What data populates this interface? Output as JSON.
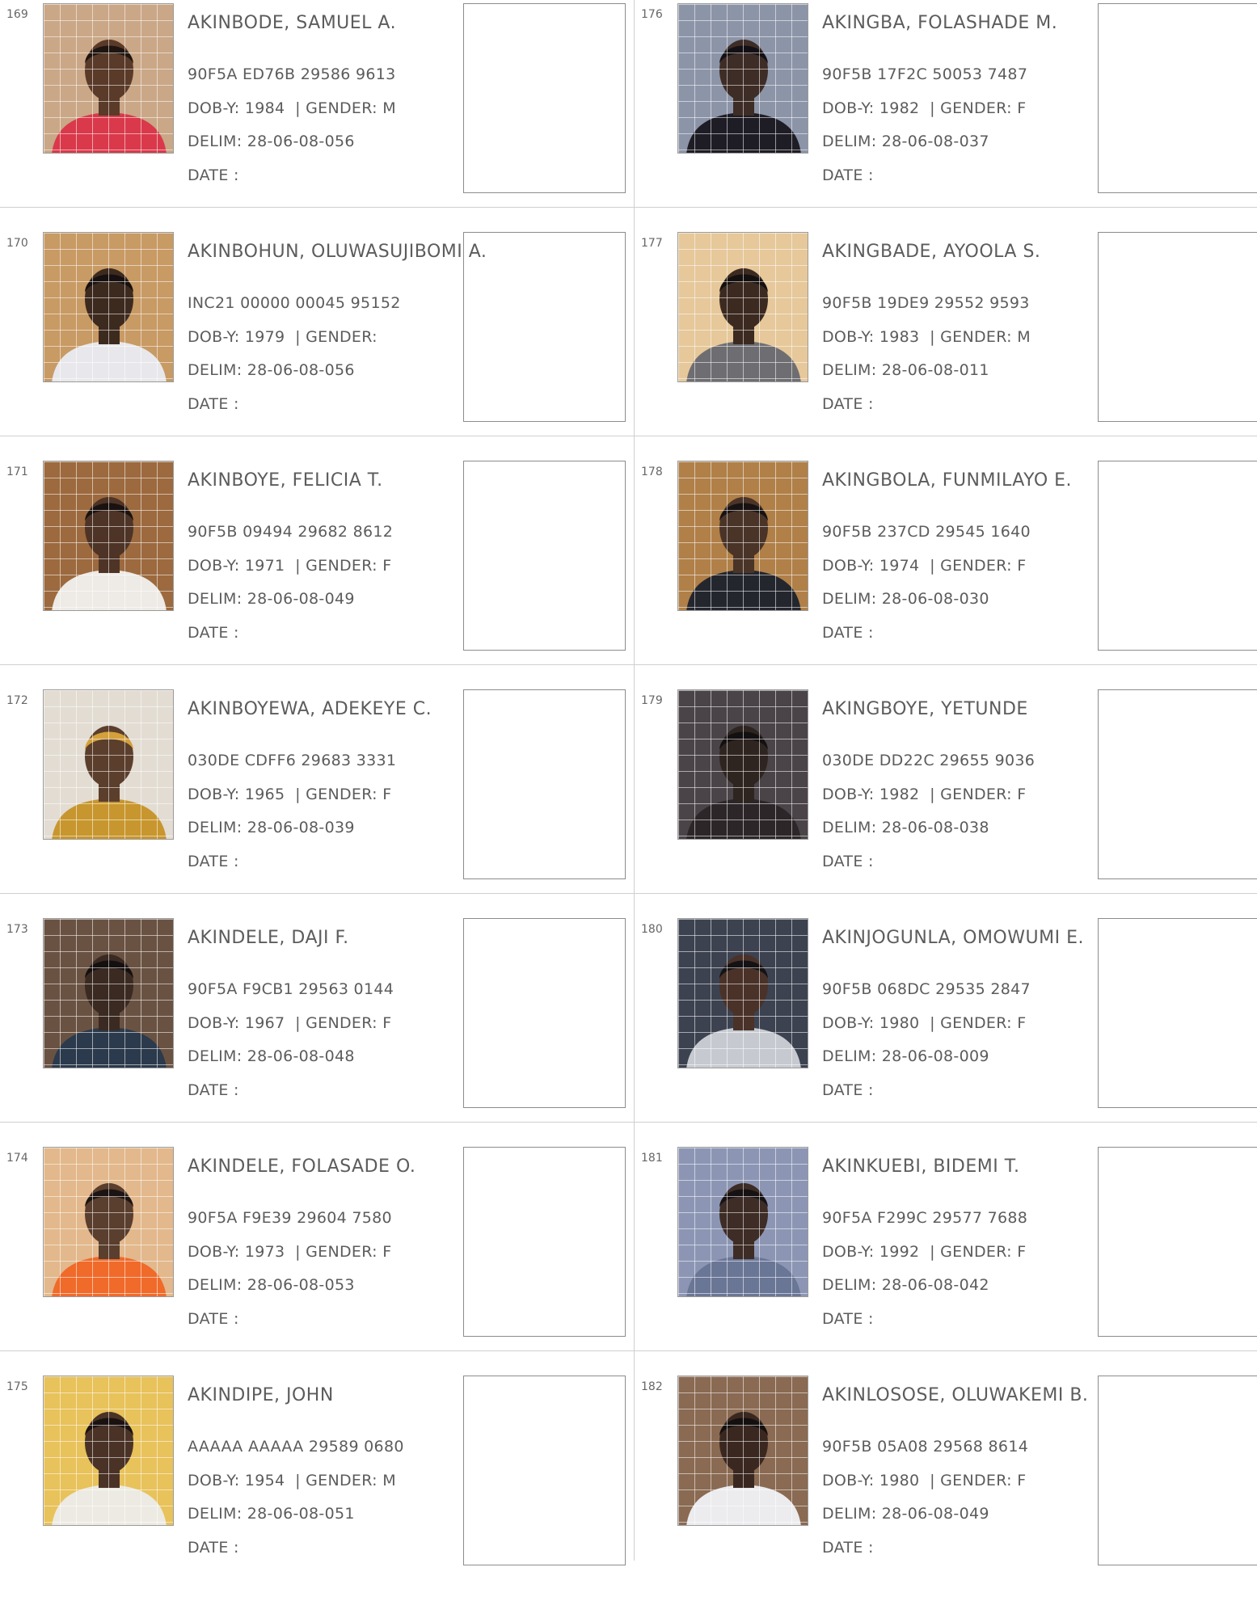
{
  "entries": [
    {
      "serial": "169",
      "name": "AKINBODE, SAMUEL A.",
      "vin": "90F5A ED76B 29586 9613",
      "dob": "1984",
      "gender": "M",
      "delim": "28-06-08-056",
      "date_label": "DATE  :",
      "photo": {
        "bg": "#caa786",
        "shirt": "#d9394a",
        "skin": "#5a3a28",
        "hair": "#1e1410"
      }
    },
    {
      "serial": "170",
      "name": "AKINBOHUN, OLUWASUJIBOMI A.",
      "vin": "INC21 00000 00045 95152",
      "dob": "1979",
      "gender": "",
      "delim": "28-06-08-056",
      "date_label": "DATE  :",
      "photo": {
        "bg": "#c89a64",
        "shirt": "#e8e8ec",
        "skin": "#3d2a1f",
        "hair": "#161010"
      }
    },
    {
      "serial": "171",
      "name": "AKINBOYE, FELICIA T.",
      "vin": "90F5B 09494 29682 8612",
      "dob": "1971",
      "gender": "F",
      "delim": "28-06-08-049",
      "date_label": "DATE  :",
      "photo": {
        "bg": "#9c6a3e",
        "shirt": "#eeeae6",
        "skin": "#4e3426",
        "hair": "#1a1210"
      }
    },
    {
      "serial": "172",
      "name": "AKINBOYEWA, ADEKEYE C.",
      "vin": "030DE CDFF6 29683 3331",
      "dob": "1965",
      "gender": "F",
      "delim": "28-06-08-039",
      "date_label": "DATE  :",
      "photo": {
        "bg": "#e2dcd2",
        "shirt": "#c8962e",
        "skin": "#5b3e2c",
        "hair": "#d4a03a"
      }
    },
    {
      "serial": "173",
      "name": "AKINDELE, DAJI F.",
      "vin": "90F5A F9CB1 29563 0144",
      "dob": "1967",
      "gender": "F",
      "delim": "28-06-08-048",
      "date_label": "DATE  :",
      "photo": {
        "bg": "#6a5242",
        "shirt": "#2b3a4c",
        "skin": "#3b2a22",
        "hair": "#141010"
      }
    },
    {
      "serial": "174",
      "name": "AKINDELE, FOLASADE O.",
      "vin": "90F5A F9E39 29604 7580",
      "dob": "1973",
      "gender": "F",
      "delim": "28-06-08-053",
      "date_label": "DATE  :",
      "photo": {
        "bg": "#e2b88c",
        "shirt": "#f06a2a",
        "skin": "#5a3e2e",
        "hair": "#1c1412"
      }
    },
    {
      "serial": "175",
      "name": "AKINDIPE, JOHN",
      "vin": "AAAAA AAAAA 29589 0680",
      "dob": "1954",
      "gender": "M",
      "delim": "28-06-08-051",
      "date_label": "DATE  :",
      "photo": {
        "bg": "#e8c25a",
        "shirt": "#eceae2",
        "skin": "#4a3226",
        "hair": "#1a1210"
      }
    },
    {
      "serial": "176",
      "name": "AKINGBA, FOLASHADE M.",
      "vin": "90F5B 17F2C 50053 7487",
      "dob": "1982",
      "gender": "F",
      "delim": "28-06-08-037",
      "date_label": "DATE  :",
      "photo": {
        "bg": "#8c94a8",
        "shirt": "#1e1c24",
        "skin": "#3e2c26",
        "hair": "#121014"
      }
    },
    {
      "serial": "177",
      "name": "AKINGBADE, AYOOLA S.",
      "vin": "90F5B 19DE9 29552 9593",
      "dob": "1983",
      "gender": "M",
      "delim": "28-06-08-011",
      "date_label": "DATE  :",
      "photo": {
        "bg": "#e6c89a",
        "shirt": "#6e6e72",
        "skin": "#3c2a20",
        "hair": "#141010"
      }
    },
    {
      "serial": "178",
      "name": "AKINGBOLA, FUNMILAYO E.",
      "vin": "90F5B 237CD 29545 1640",
      "dob": "1974",
      "gender": "F",
      "delim": "28-06-08-030",
      "date_label": "DATE  :",
      "photo": {
        "bg": "#b08048",
        "shirt": "#24262e",
        "skin": "#4a3428",
        "hair": "#181212"
      }
    },
    {
      "serial": "179",
      "name": "AKINGBOYE, YETUNDE",
      "vin": "030DE DD22C 29655 9036",
      "dob": "1982",
      "gender": "F",
      "delim": "28-06-08-038",
      "date_label": "DATE  :",
      "photo": {
        "bg": "#4a4448",
        "shirt": "#2c2628",
        "skin": "#2e2420",
        "hair": "#121010"
      }
    },
    {
      "serial": "180",
      "name": "AKINJOGUNLA, OMOWUMI E.",
      "vin": "90F5B 068DC 29535 2847",
      "dob": "1980",
      "gender": "F",
      "delim": "28-06-08-009",
      "date_label": "DATE  :",
      "photo": {
        "bg": "#3c4250",
        "shirt": "#c6cad0",
        "skin": "#4a3228",
        "hair": "#141214"
      }
    },
    {
      "serial": "181",
      "name": "AKINKUEBI, BIDEMI T.",
      "vin": "90F5A F299C 29577 7688",
      "dob": "1992",
      "gender": "F",
      "delim": "28-06-08-042",
      "date_label": "DATE  :",
      "photo": {
        "bg": "#8c96b4",
        "shirt": "#6a7696",
        "skin": "#3e2c26",
        "hair": "#161214"
      }
    },
    {
      "serial": "182",
      "name": "AKINLOSOSE, OLUWAKEMI B.",
      "vin": "90F5B 05A08 29568 8614",
      "dob": "1980",
      "gender": "F",
      "delim": "28-06-08-049",
      "date_label": "DATE  :",
      "photo": {
        "bg": "#8a6a52",
        "shirt": "#ecebee",
        "skin": "#3a2820",
        "hair": "#141010"
      }
    }
  ]
}
